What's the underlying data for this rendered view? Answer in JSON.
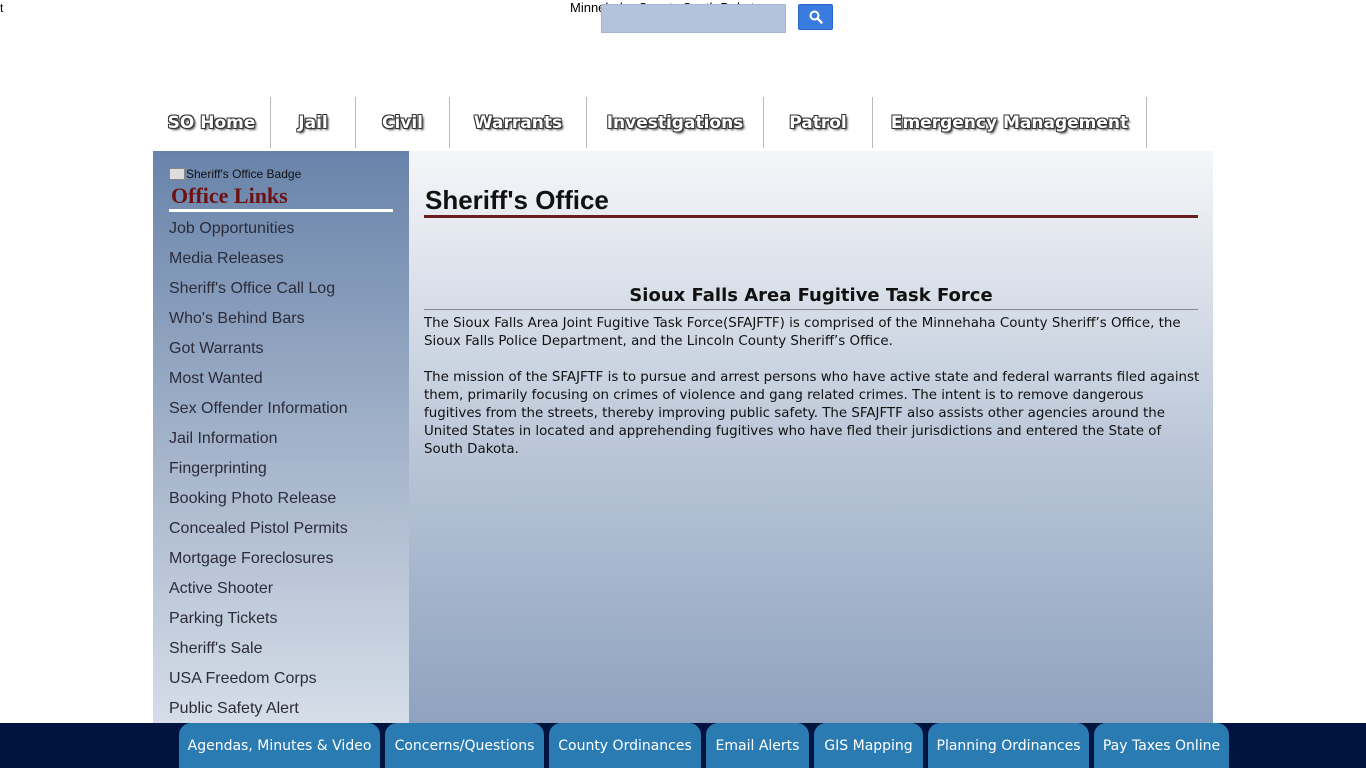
{
  "header": {
    "corner_text": "t",
    "site_title": "Minnehaha County South Dakota",
    "search_icon": "search-icon"
  },
  "nav": {
    "items": [
      {
        "label": "SO Home",
        "width": 118
      },
      {
        "label": "Jail",
        "width": 85
      },
      {
        "label": "Civil",
        "width": 94
      },
      {
        "label": "Warrants",
        "width": 137
      },
      {
        "label": "Investigations",
        "width": 177
      },
      {
        "label": "Patrol",
        "width": 109
      },
      {
        "label": "Emergency Management",
        "width": 274
      }
    ]
  },
  "sidebar": {
    "badge_alt": "Sheriff's Office Badge",
    "heading": "Office Links",
    "links": [
      "Job Opportunities",
      "Media Releases",
      "Sheriff's Office Call Log",
      "Who's Behind Bars",
      "Got Warrants",
      "Most Wanted",
      "Sex Offender Information",
      "Jail Information",
      "Fingerprinting",
      "Booking Photo Release",
      "Concealed Pistol Permits",
      "Mortgage Foreclosures",
      "Active Shooter",
      "Parking Tickets",
      "Sheriff's Sale",
      "USA Freedom Corps",
      "Public Safety Alert"
    ]
  },
  "main": {
    "title": "Sheriff's Office",
    "section_title": "Sioux Falls Area Fugitive Task Force",
    "paragraph1": "The Sioux Falls Area Joint Fugitive Task Force(SFAJFTF) is comprised of the Minnehaha County Sheriff’s Office, the Sioux Falls Police Department, and the Lincoln County Sheriff’s Office.",
    "paragraph2": "The mission of the SFAJFTF is to pursue and arrest persons who have active state and federal warrants filed against them, primarily focusing on crimes of violence and gang related crimes.  The intent is to remove dangerous fugitives from the streets, thereby improving public safety.  The SFAJFTF also assists other agencies around the United States in located and apprehending fugitives who have fled their jurisdictions and entered the State of South Dakota."
  },
  "footer": {
    "buttons": [
      "Agendas, Minutes & Video",
      "Concerns/Questions",
      "County Ordinances",
      "Email Alerts",
      "GIS Mapping",
      "Planning Ordinances",
      "Pay Taxes Online"
    ]
  },
  "colors": {
    "footer_bg": "#011440",
    "footer_button": "#2b7bb3",
    "heading_accent": "#6b1111",
    "search_button": "#3a7be0"
  }
}
